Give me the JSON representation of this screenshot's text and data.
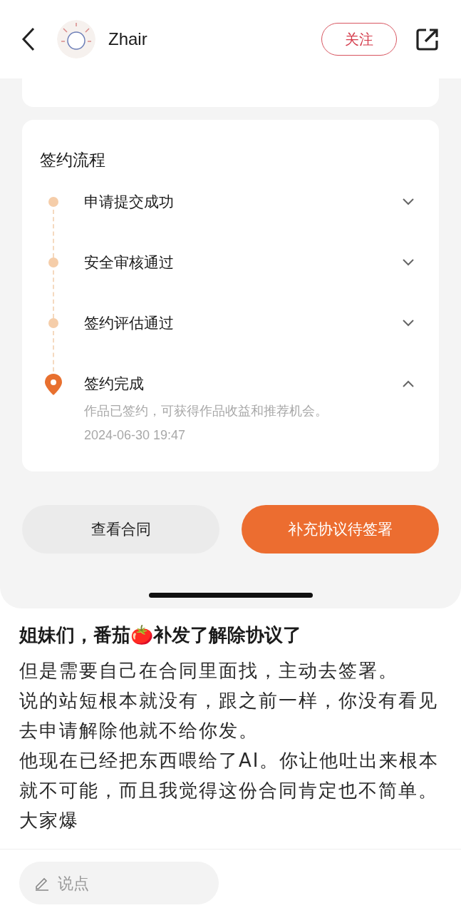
{
  "header": {
    "name": "Zhair",
    "follow_button": "关注"
  },
  "process": {
    "title": "签约流程",
    "steps": [
      {
        "title": "申请提交成功",
        "current": false,
        "expanded": false
      },
      {
        "title": "安全审核通过",
        "current": false,
        "expanded": false
      },
      {
        "title": "签约评估通过",
        "current": false,
        "expanded": false
      },
      {
        "title": "签约完成",
        "current": true,
        "expanded": true,
        "description": "作品已签约，可获得作品收益和推荐机会。",
        "time": "2024-06-30 19:47"
      }
    ]
  },
  "buttons": [
    {
      "label": "查看合同",
      "kind": "secondary"
    },
    {
      "label": "补充协议待签署",
      "kind": "primary"
    }
  ],
  "post": {
    "title": "姐妹们，番茄🍅补发了解除协议了",
    "paragraphs": [
      "但是需要自己在合同里面找，主动去签署。",
      "说的站短根本就没有，跟之前一样，你没有看见去申请解除他就不给你发。",
      "他现在已经把东西喂给了AI。你让他吐出来根本就不可能，而且我觉得这份合同肯定也不简单。",
      "大家爆"
    ]
  },
  "comment": {
    "placeholder": "说点"
  }
}
